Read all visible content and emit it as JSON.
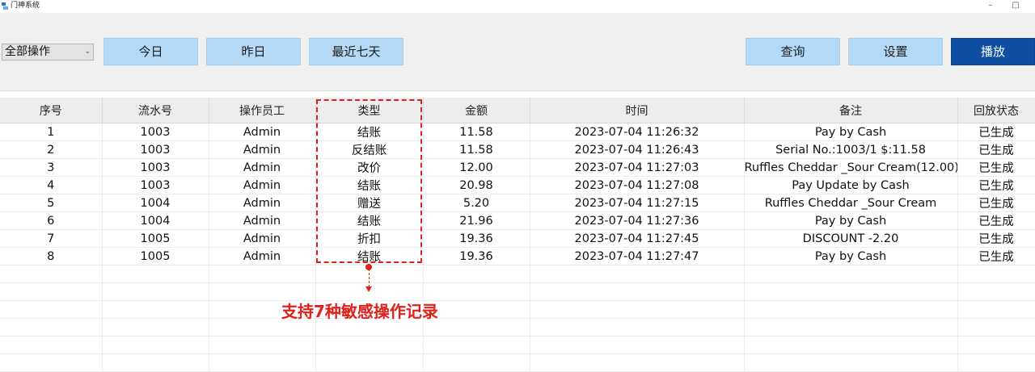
{
  "window": {
    "title": "门神系统",
    "minimize_glyph": "–",
    "maximize_glyph": "□"
  },
  "toolbar": {
    "filter_select": {
      "value": "全部操作",
      "chevron": "⌄"
    },
    "today": "今日",
    "yesterday": "昨日",
    "last7": "最近七天",
    "query": "查询",
    "settings": "设置",
    "play": "播放"
  },
  "table": {
    "columns": [
      "序号",
      "流水号",
      "操作员工",
      "类型",
      "金额",
      "时间",
      "备注",
      "回放状态"
    ],
    "rows": [
      [
        "1",
        "1003",
        "Admin",
        "结账",
        "11.58",
        "2023-07-04 11:26:32",
        "Pay by Cash",
        "已生成"
      ],
      [
        "2",
        "1003",
        "Admin",
        "反结账",
        "11.58",
        "2023-07-04 11:26:43",
        "Serial No.:1003/1  $:11.58",
        "已生成"
      ],
      [
        "3",
        "1003",
        "Admin",
        "改价",
        "12.00",
        "2023-07-04 11:27:03",
        "Ruffles Cheddar _Sour Cream(12.00)",
        "已生成"
      ],
      [
        "4",
        "1003",
        "Admin",
        "结账",
        "20.98",
        "2023-07-04 11:27:08",
        "Pay Update by Cash",
        "已生成"
      ],
      [
        "5",
        "1004",
        "Admin",
        "赠送",
        "5.20",
        "2023-07-04 11:27:15",
        "Ruffles Cheddar _Sour Cream",
        "已生成"
      ],
      [
        "6",
        "1004",
        "Admin",
        "结账",
        "21.96",
        "2023-07-04 11:27:36",
        "Pay by Cash",
        "已生成"
      ],
      [
        "7",
        "1005",
        "Admin",
        "折扣",
        "19.36",
        "2023-07-04 11:27:45",
        "DISCOUNT -2.20",
        "已生成"
      ],
      [
        "8",
        "1005",
        "Admin",
        "结账",
        "19.36",
        "2023-07-04 11:27:47",
        "Pay by Cash",
        "已生成"
      ]
    ]
  },
  "annotation": {
    "callout": "支持7种敏感操作记录",
    "color": "#e0211b"
  },
  "colors": {
    "button_bg": "#b3d9f7",
    "primary_bg": "#0f4fa3",
    "toolbar_bg": "#f0f0f0",
    "header_bg": "#ededed"
  }
}
